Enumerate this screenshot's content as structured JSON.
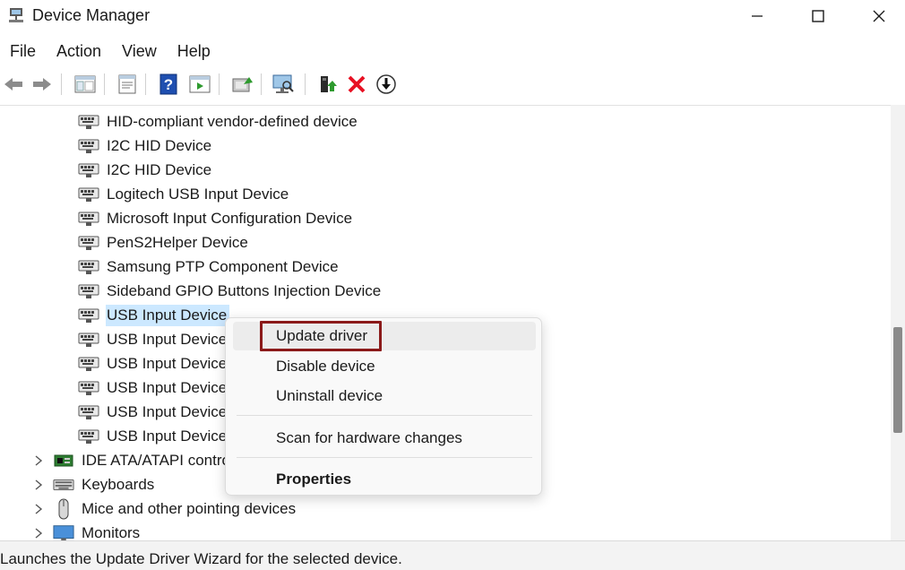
{
  "window": {
    "title": "Device Manager"
  },
  "menu": [
    "File",
    "Action",
    "View",
    "Help"
  ],
  "toolbar": {
    "icons": [
      "back-arrow-icon",
      "forward-arrow-icon",
      "show-hide-console-tree-icon",
      "properties-icon",
      "help-icon",
      "run-icon",
      "update-driver-icon",
      "scan-hardware-icon",
      "enable-device-icon",
      "uninstall-device-icon",
      "download-icon"
    ]
  },
  "tree": {
    "devices": [
      "HID-compliant vendor-defined device",
      "I2C HID Device",
      "I2C HID Device",
      "Logitech USB Input Device",
      "Microsoft Input Configuration Device",
      "PenS2Helper Device",
      "Samsung PTP Component Device",
      "Sideband GPIO Buttons Injection Device",
      "USB Input Device",
      "USB Input Device",
      "USB Input Device",
      "USB Input Device",
      "USB Input Device",
      "USB Input Device"
    ],
    "categories": [
      "IDE ATA/ATAPI controllers",
      "Keyboards",
      "Mice and other pointing devices",
      "Monitors"
    ]
  },
  "context_menu": {
    "update_driver": "Update driver",
    "disable_device": "Disable device",
    "uninstall_device": "Uninstall device",
    "scan_hardware": "Scan for hardware changes",
    "properties": "Properties"
  },
  "status": {
    "text": "Launches the Update Driver Wizard for the selected device."
  },
  "colors": {
    "selection": "#cce8ff",
    "highlight_border": "#8b1a1a",
    "delete_red": "#e81123"
  }
}
